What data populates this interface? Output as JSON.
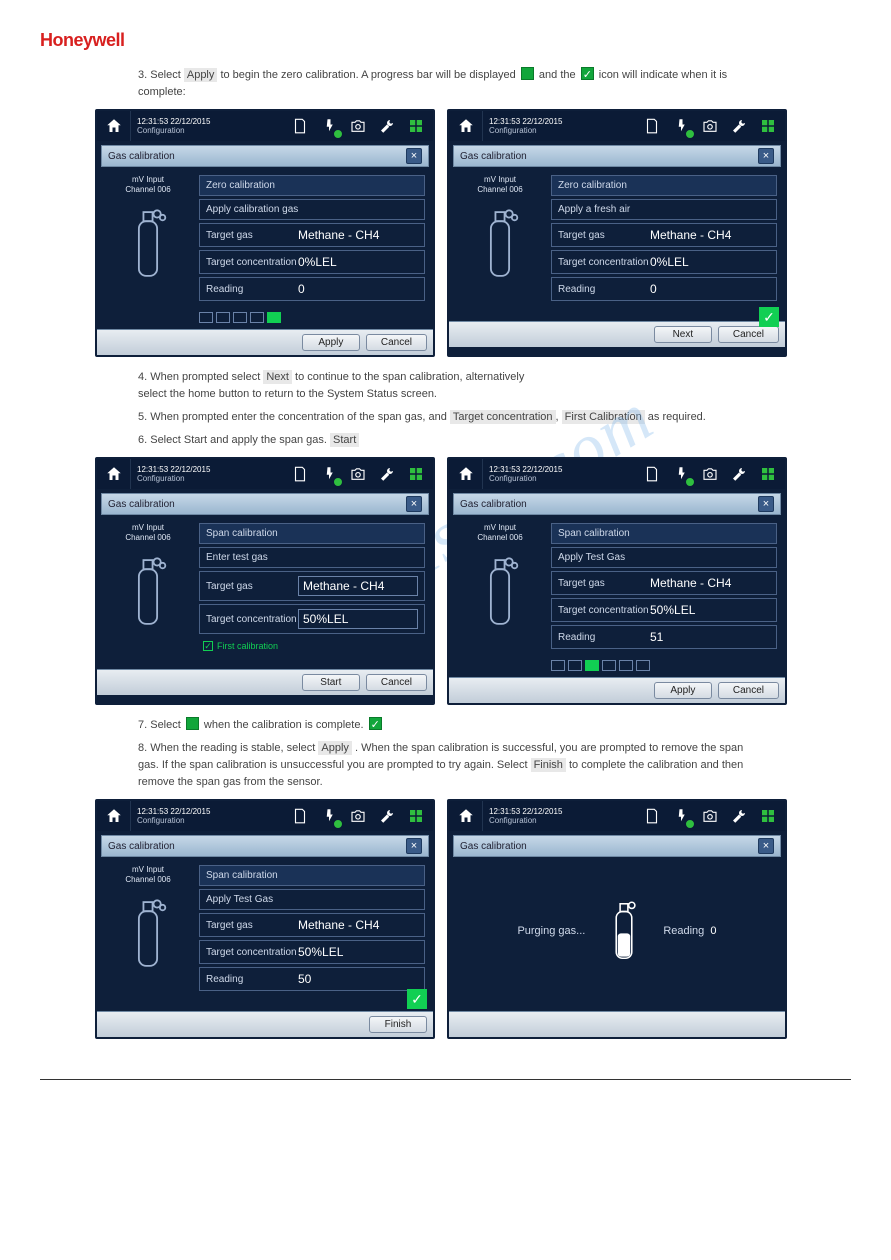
{
  "brand": "Honeywell",
  "watermark": "manualslib.com",
  "common": {
    "timestamp": "12:31:53  22/12/2015",
    "breadcrumb": "Configuration",
    "panel_title": "Gas calibration",
    "channel_label_1": "mV Input",
    "channel_label_2": "Channel 006",
    "kv_target_gas": "Target gas",
    "kv_target_conc": "Target concentration",
    "kv_reading": "Reading",
    "gas_name": "Methane - CH4",
    "zero_conc": "0%LEL",
    "span_conc": "50%LEL",
    "btn_apply": "Apply",
    "btn_cancel": "Cancel",
    "btn_next": "Next",
    "btn_start": "Start",
    "btn_finish": "Finish"
  },
  "instr": {
    "s3a": "3. Select ",
    "s3b": " to begin the zero calibration. A progress bar will be displayed",
    "s3c": " and the ",
    "s3d": " icon will indicate when it is complete:",
    "s4a": "4. When prompted select ",
    "s4b": " to continue to the span calibration, alternatively",
    "s4c": "select the home button to return to the System Status screen.",
    "s5a": "5. When prompted enter the concentration of the span gas, and ",
    "s5b": " as required.",
    "s6": "6. Select Start and apply the span gas.",
    "s7a": "7. Select ",
    "s7b": " when the calibration is complete.",
    "s8a": "8. When the reading is stable, select ",
    "s8b": ". When the span calibration is successful, you are prompted to remove the span gas. If the span calibration is unsuccessful you",
    "s8c": " are prompted to try again. Select ",
    "s8d": " to complete the calibration and then",
    "s8e": " remove the span gas from the sensor.",
    "hl_apply": "Apply",
    "hl_next": "Next",
    "hl_target_conc": "Target concentration",
    "hl_first_cal": "First Calibration",
    "hl_start": "Start",
    "hl_finish": "Finish"
  },
  "screens": {
    "zero1": {
      "section": "Zero calibration",
      "action": "Apply calibration gas",
      "reading": "0"
    },
    "zero2": {
      "section": "Zero calibration",
      "action": "Apply a fresh air",
      "reading": "0"
    },
    "span1": {
      "section": "Span calibration",
      "action": "Enter test gas",
      "checkbox": "First calibration"
    },
    "span2": {
      "section": "Span calibration",
      "action": "Apply Test Gas",
      "reading": "51"
    },
    "span3": {
      "section": "Span calibration",
      "action": "Apply Test Gas",
      "reading": "50"
    },
    "purge": {
      "msg": "Purging gas...",
      "reading_label": "Reading",
      "reading": "0"
    }
  },
  "footer": {
    "left": "",
    "center": "",
    "right": ""
  }
}
